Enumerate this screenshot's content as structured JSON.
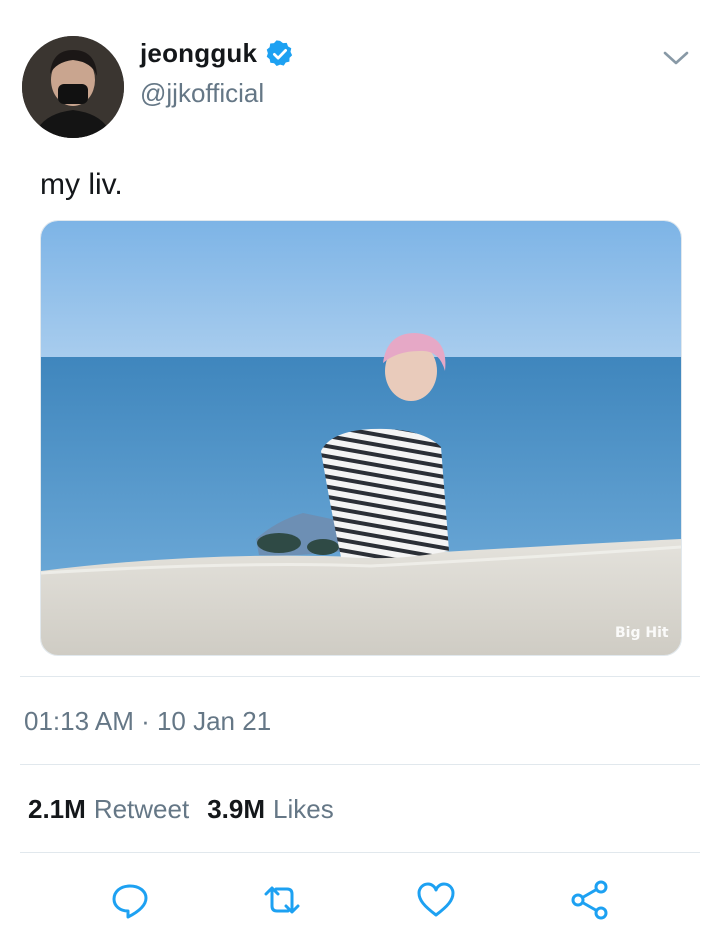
{
  "user": {
    "display_name": "jeongguk",
    "handle": "@jjkofficial",
    "verified": true
  },
  "tweet": {
    "text": "my liv.",
    "image_watermark": "Big Hit",
    "timestamp": "01:13 AM · 10 Jan 21"
  },
  "stats": {
    "retweets_count": "2.1M",
    "retweets_label": "Retweet",
    "likes_count": "3.9M",
    "likes_label": "Likes"
  },
  "actions": [
    "reply-icon",
    "retweet-icon",
    "like-icon",
    "share-icon"
  ],
  "colors": {
    "verified_blue": "#1da1f2",
    "secondary_text": "#657786",
    "icon_blue": "#1da1f2"
  }
}
